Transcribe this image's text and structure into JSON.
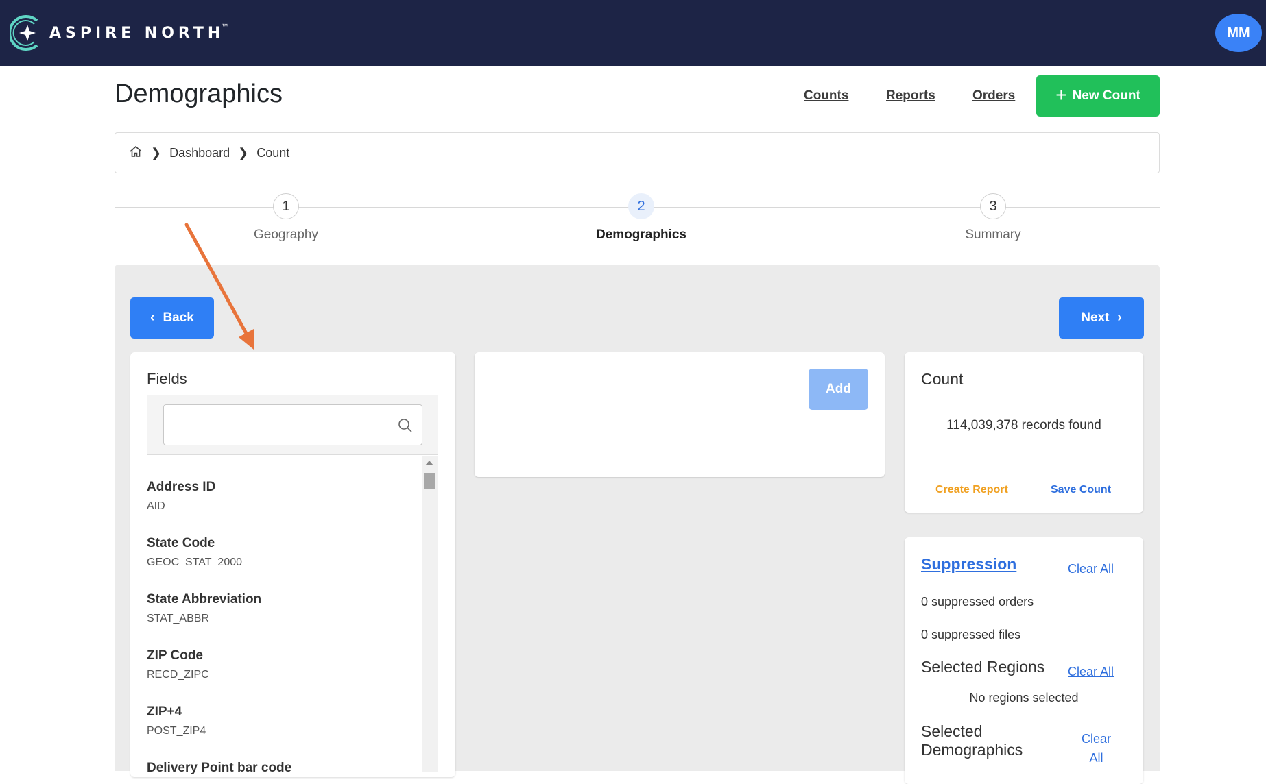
{
  "app": {
    "brand": "ASPIRE NORTH",
    "brand_tm": "™",
    "user_initials": "MM"
  },
  "header": {
    "title": "Demographics",
    "links": [
      "Counts",
      "Reports",
      "Orders"
    ],
    "new_count_label": "New Count",
    "new_count_icon": "plus-icon"
  },
  "breadcrumb": {
    "home_icon": "home-icon",
    "items": [
      "Dashboard",
      "Count"
    ]
  },
  "stepper": {
    "steps": [
      {
        "number": "1",
        "label": "Geography",
        "active": false
      },
      {
        "number": "2",
        "label": "Demographics",
        "active": true
      },
      {
        "number": "3",
        "label": "Summary",
        "active": false
      }
    ]
  },
  "nav": {
    "back_label": "Back",
    "next_label": "Next"
  },
  "fields": {
    "title": "Fields",
    "search_placeholder": "",
    "items": [
      {
        "name": "Address ID",
        "code": "AID"
      },
      {
        "name": "State Code",
        "code": "GEOC_STAT_2000"
      },
      {
        "name": "State Abbreviation",
        "code": "STAT_ABBR"
      },
      {
        "name": "ZIP Code",
        "code": "RECD_ZIPC"
      },
      {
        "name": "ZIP+4",
        "code": "POST_ZIP4"
      },
      {
        "name": "Delivery Point bar code",
        "code": ""
      }
    ]
  },
  "builder": {
    "add_label": "Add"
  },
  "count": {
    "title": "Count",
    "records": "114,039,378 records found",
    "create_report": "Create Report",
    "save_count": "Save Count"
  },
  "suppression": {
    "title": "Suppression",
    "clear_all": "Clear All",
    "orders_text": "0 suppressed orders",
    "files_text": "0 suppressed files",
    "regions_title": "Selected Regions",
    "regions_clear": "Clear All",
    "no_regions": "No regions selected",
    "demo_title_line1": "Selected",
    "demo_title_line2": "Demographics",
    "demo_clear_line1": "Clear",
    "demo_clear_line2": "All"
  },
  "colors": {
    "topbar": "#1d2446",
    "primary": "#2f7ff5",
    "success": "#21c05a",
    "warning": "#f0a020",
    "annotation_arrow": "#e8743b"
  }
}
